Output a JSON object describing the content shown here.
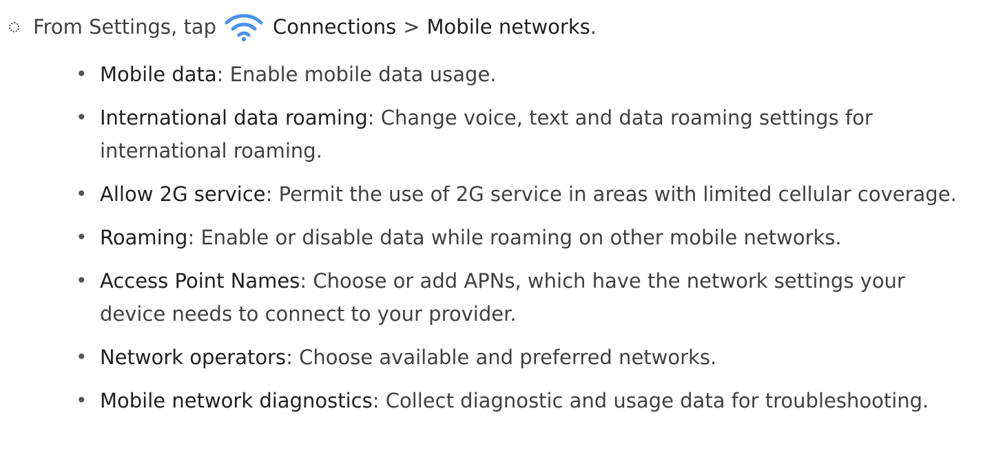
{
  "step": {
    "prefix": "From Settings, tap",
    "icon": "wifi-icon",
    "icon_color": "#4a90f0",
    "menu1": "Connections",
    "separator": ">",
    "menu2": "Mobile networks",
    "suffix": "."
  },
  "options": [
    {
      "term": "Mobile data",
      "desc": ": Enable mobile data usage."
    },
    {
      "term": "International data roaming",
      "desc": ": Change voice, text and data roaming settings for international roaming."
    },
    {
      "term": "Allow 2G service",
      "desc": ": Permit the use of 2G service in areas with limited cellular coverage."
    },
    {
      "term": "Roaming",
      "desc": ": Enable or disable data while roaming on other mobile networks."
    },
    {
      "term": "Access Point Names",
      "desc": ": Choose or add APNs, which have the network settings your device needs to connect to your provider."
    },
    {
      "term": "Network operators",
      "desc": ": Choose available and preferred networks."
    },
    {
      "term": "Mobile network diagnostics",
      "desc": ": Collect diagnostic and usage data for troubleshooting."
    }
  ]
}
